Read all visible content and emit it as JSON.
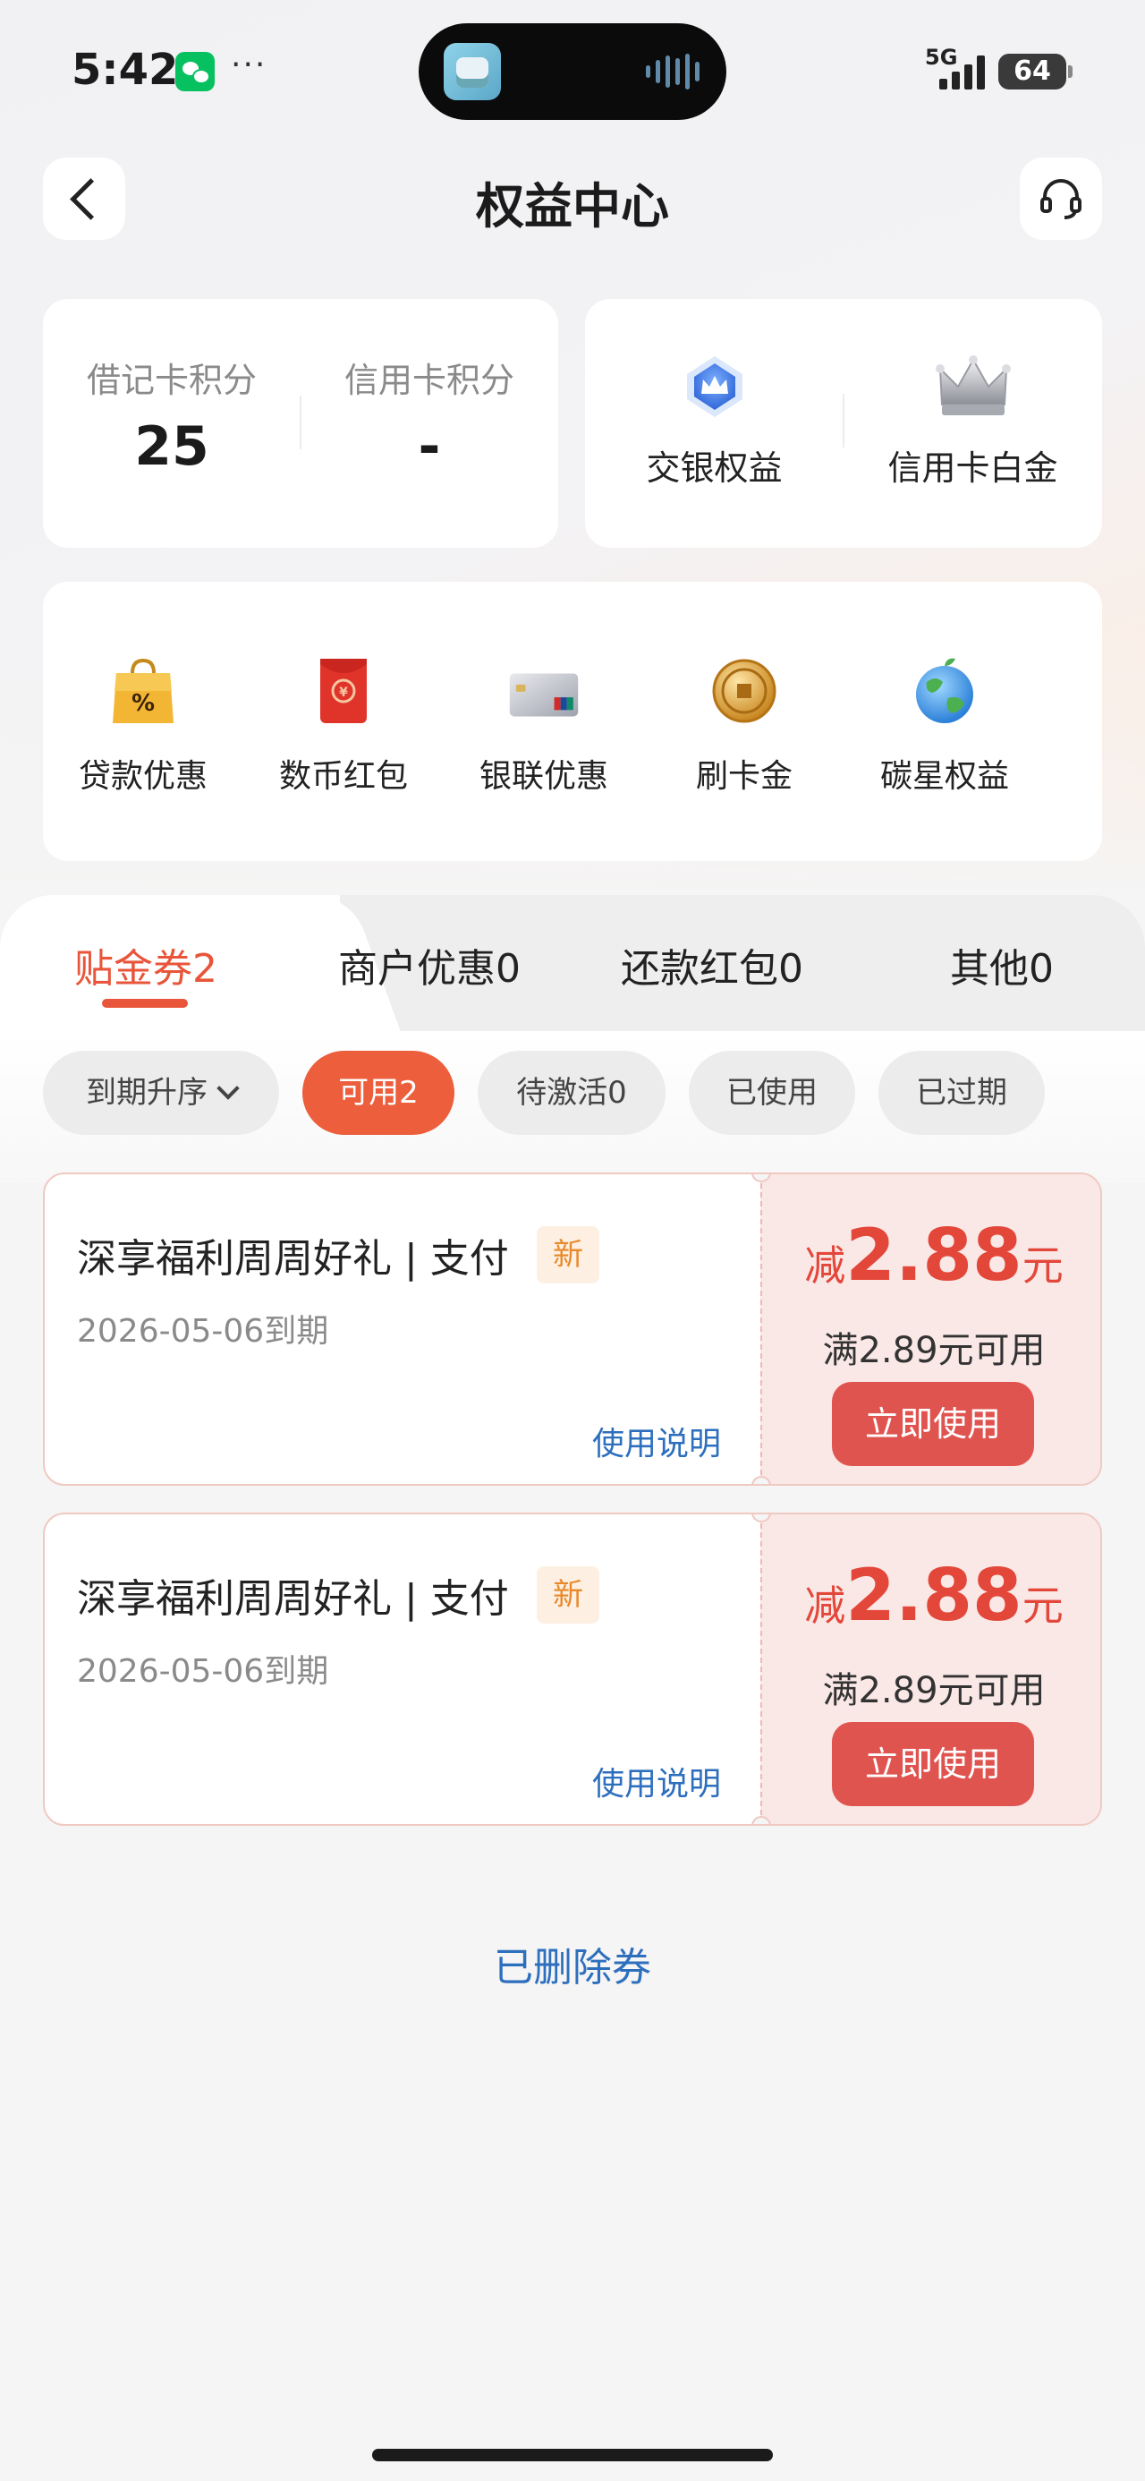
{
  "status_bar": {
    "time": "5:42",
    "network": "5G",
    "battery": "64"
  },
  "header": {
    "title": "权益中心"
  },
  "points": [
    {
      "label": "借记卡积分",
      "value": "25"
    },
    {
      "label": "信用卡积分",
      "value": "-"
    }
  ],
  "benefits": [
    {
      "label": "交银权益",
      "icon": "blue-crown-icon"
    },
    {
      "label": "信用卡白金",
      "icon": "silver-crown-icon"
    }
  ],
  "shortcuts": [
    {
      "label": "贷款优惠",
      "icon": "shopping-bag-percent-icon"
    },
    {
      "label": "数币红包",
      "icon": "red-envelope-icon"
    },
    {
      "label": "银联优惠",
      "icon": "unionpay-card-icon"
    },
    {
      "label": "刷卡金",
      "icon": "gold-coin-icon"
    },
    {
      "label": "碳星权益",
      "icon": "earth-globe-icon"
    }
  ],
  "tabs": [
    {
      "label": "贴金券2",
      "active": true
    },
    {
      "label": "商户优惠0",
      "active": false
    },
    {
      "label": "还款红包0",
      "active": false
    },
    {
      "label": "其他0",
      "active": false
    }
  ],
  "filters": {
    "sort_label": "到期升序",
    "chips": [
      {
        "label": "可用2",
        "active": true
      },
      {
        "label": "待激活0",
        "active": false
      },
      {
        "label": "已使用",
        "active": false
      },
      {
        "label": "已过期",
        "active": false
      }
    ]
  },
  "coupons": [
    {
      "title": "深享福利周周好礼 | 支付",
      "badge": "新",
      "expiry": "2026-05-06到期",
      "guide": "使用说明",
      "prefix": "减",
      "amount": "2.88",
      "suffix": "元",
      "condition": "满2.89元可用",
      "button": "立即使用"
    },
    {
      "title": "深享福利周周好礼 | 支付",
      "badge": "新",
      "expiry": "2026-05-06到期",
      "guide": "使用说明",
      "prefix": "减",
      "amount": "2.88",
      "suffix": "元",
      "condition": "满2.89元可用",
      "button": "立即使用"
    }
  ],
  "footer": {
    "deleted_link": "已删除券"
  },
  "colors": {
    "accent": "#e8553a",
    "link": "#2e6fbd",
    "coupon_red": "#e3473a",
    "button_red": "#e05450"
  }
}
